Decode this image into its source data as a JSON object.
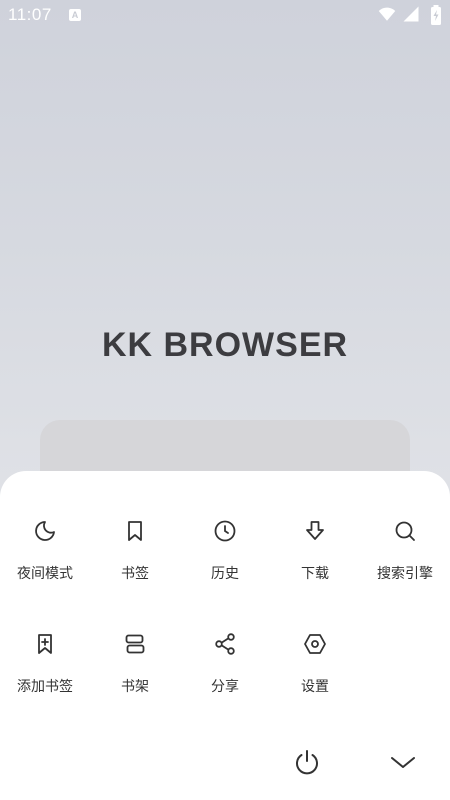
{
  "status_bar": {
    "time": "11:07",
    "notification_icon": "A"
  },
  "brand": {
    "title": "KK BROWSER"
  },
  "menu": {
    "items": [
      {
        "label": "夜间模式",
        "icon": "moon-icon"
      },
      {
        "label": "书签",
        "icon": "bookmark-icon"
      },
      {
        "label": "历史",
        "icon": "clock-icon"
      },
      {
        "label": "下载",
        "icon": "download-icon"
      },
      {
        "label": "搜索引擎",
        "icon": "search-icon"
      },
      {
        "label": "添加书签",
        "icon": "add-bookmark-icon"
      },
      {
        "label": "书架",
        "icon": "bookshelf-icon"
      },
      {
        "label": "分享",
        "icon": "share-icon"
      },
      {
        "label": "设置",
        "icon": "settings-icon"
      }
    ]
  },
  "bottom_actions": {
    "power": "power-icon",
    "close": "chevron-down-icon"
  },
  "colors": {
    "sheet": "#ffffff",
    "text": "#333333",
    "brand_text": "#3c3c40"
  }
}
